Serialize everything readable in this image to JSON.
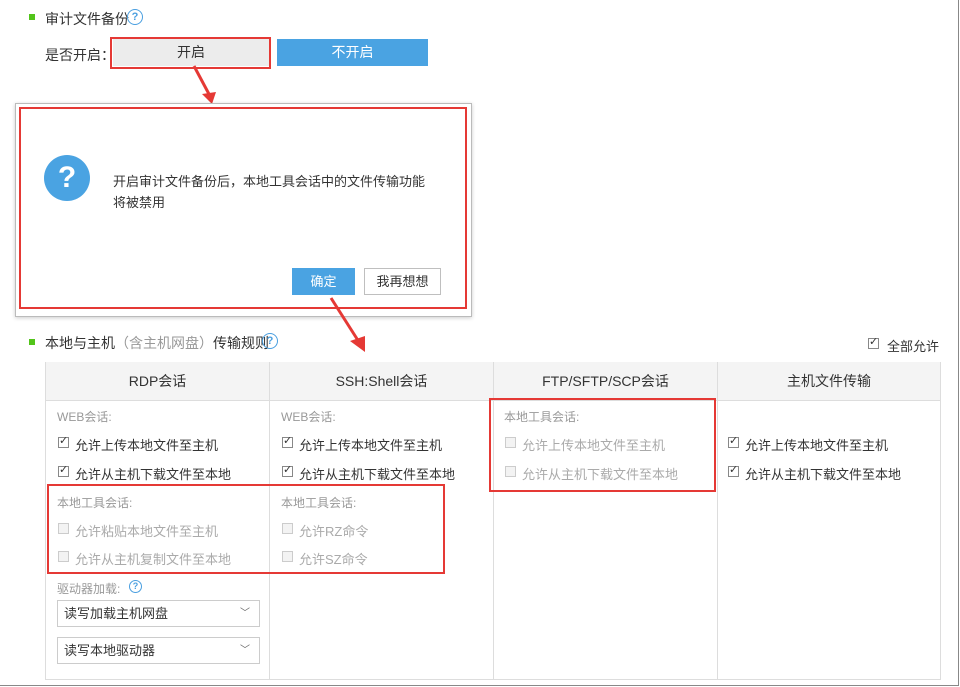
{
  "audit": {
    "title": "审计文件备份",
    "enable_label": "是否开启：",
    "btn_on": "开启",
    "btn_off": "不开启"
  },
  "dialog": {
    "message_line1": "开启审计文件备份后，本地工具会话中的文件传输功能",
    "message_line2": "将被禁用",
    "confirm": "确定",
    "cancel": "我再想想"
  },
  "rules": {
    "title": "本地与主机",
    "title_note": "（含主机网盘）",
    "title_suffix": "传输规则",
    "allow_all": "全部允许"
  },
  "columns": [
    {
      "header": "RDP会话"
    },
    {
      "header": "SSH:Shell会话"
    },
    {
      "header": "FTP/SFTP/SCP会话"
    },
    {
      "header": "主机文件传输"
    }
  ],
  "rdp": {
    "web_group": "WEB会话:",
    "web_upload": "允许上传本地文件至主机",
    "web_download": "允许从主机下载文件至本地",
    "local_group": "本地工具会话:",
    "local_paste": "允许粘贴本地文件至主机",
    "local_copy": "允许从主机复制文件至本地",
    "drive_group": "驱动器加载:",
    "select1": "读写加载主机网盘",
    "select2": "读写本地驱动器"
  },
  "ssh": {
    "web_group": "WEB会话:",
    "web_upload": "允许上传本地文件至主机",
    "web_download": "允许从主机下载文件至本地",
    "local_group": "本地工具会话:",
    "rz": "允许RZ命令",
    "sz": "允许SZ命令"
  },
  "ftp": {
    "local_group": "本地工具会话:",
    "upload": "允许上传本地文件至主机",
    "download": "允许从主机下载文件至本地"
  },
  "host": {
    "upload": "允许上传本地文件至主机",
    "download": "允许从主机下载文件至本地"
  },
  "colors": {
    "accent": "#4aa3e2",
    "highlight": "#e53935",
    "marker": "#52c41a"
  }
}
